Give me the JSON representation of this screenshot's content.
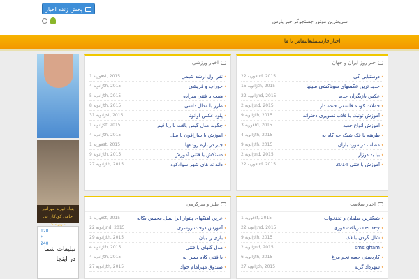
{
  "topbar": {
    "live_button": "پخش زنده اخبار"
  },
  "header": {
    "tagline": "سریعترین موتور جستجوگر خبر پارس"
  },
  "nav": {
    "text": "اخبار فارسیتبلیغاتتماس با ما"
  },
  "ads": {
    "ad2_line1": "بنیاد خیریه مهرانور",
    "ad2_line2": "حامی کودکان بی سرپرست",
    "ad3_nums": "120\n*\n240",
    "ad3_text": "تبلیغات شما\nدر اینجا"
  },
  "panels": [
    {
      "title": "خبر روز ایران و جهان",
      "items": [
        {
          "title": "دوستیابی گی",
          "date": "فوریه 22nd, 2015"
        },
        {
          "title": "جدید ترین عکسهای سوناکشی سینها",
          "date": "ژانویه 15th, 2015"
        },
        {
          "title": "عکس بازیگران جدید",
          "date": "ژانویه 22nd, 2015"
        },
        {
          "title": "جملات کوتاه فلسفی خنده دار",
          "date": "ژانویه 2nd, 2015"
        },
        {
          "title": "آموزش تونیک با قلاب تصویری دخترانه",
          "date": "ژانویه 9th, 2015"
        },
        {
          "title": "آموزش انواع جعبه",
          "date": "فوریه 3rd, 2015"
        },
        {
          "title": "طریقه با فک شیک جه گاه به",
          "date": "ژانویه 4th, 2015"
        },
        {
          "title": "مطلب در مورد باران",
          "date": "ژانویه 9th, 2015"
        },
        {
          "title": "بیا بد دوزار",
          "date": "ژانویه 2nd, 2015"
        },
        {
          "title": "آموزش با فتنی 2014",
          "date": "فوریه 22nd, 2015"
        }
      ]
    },
    {
      "title": "اخبار ورزشی",
      "items": [
        {
          "title": "نفر اول ارشد شیمی",
          "date": "فوریه 1st, 2015"
        },
        {
          "title": "جوراب و فریشی",
          "date": "ژانویه 4th, 2015"
        },
        {
          "title": "هفت با فتنی میزاده",
          "date": "ژانویه 5th, 2015"
        },
        {
          "title": "طرز با مدال داشی",
          "date": "ژانویه 8th, 2015"
        },
        {
          "title": "پلود عکس اوانونا",
          "date": "ژانویه 31st, 2015"
        },
        {
          "title": "چگونه مدل گیس بافت با ریا قیم",
          "date": "ژانویه 1st, 2015"
        },
        {
          "title": "آموزش با سازافون با میل",
          "date": "ژانویه 4th, 2015"
        },
        {
          "title": "چیز در باره زودعها",
          "date": "فوریه 1st, 2015"
        },
        {
          "title": "دستکش با فتنی آموزش",
          "date": "ژانویه 9th, 2015"
        },
        {
          "title": "داند نه های شهر سوادکوه",
          "date": "ژانویه 27th, 2015"
        }
      ]
    },
    {
      "title": "اخبار سلامت",
      "items": [
        {
          "title": "شیکترین مبلمان و تختخواب",
          "date": "فوریه 1st, 2015"
        },
        {
          "title": "cer.key دریافت فوری",
          "date": "ژانویه 22nd, 2015"
        },
        {
          "title": "شال گردن با فک",
          "date": "ژانویه 9th, 2015"
        },
        {
          "title": "sms gham",
          "date": "ژانویه 2nd, 2015"
        },
        {
          "title": "کاردستی جعبه تخم مرغ",
          "date": "ژانویه 6th, 2015"
        },
        {
          "title": "شهرداد گریه",
          "date": "ژانویه 27th, 2015"
        }
      ]
    },
    {
      "title": "طنز و سرگرمی",
      "items": [
        {
          "title": "عرین آهنگهای پیتوار آیرا نسل محسن بگانه",
          "date": "فوریه 1st, 2015"
        },
        {
          "title": "آموزش دوخت روسری",
          "date": "ژانویه 22nd, 2015"
        },
        {
          "title": "بازی را بیان",
          "date": "ژانویه 29th, 2015"
        },
        {
          "title": "مدل گلهای با فتنی",
          "date": "ژانویه 4th, 2015"
        },
        {
          "title": "با فتنی کلاه بسرا نه",
          "date": "ژانویه 4th, 2015"
        },
        {
          "title": "صندوق مهرامام جواد",
          "date": "ژانویه 27th, 2015"
        }
      ]
    }
  ]
}
